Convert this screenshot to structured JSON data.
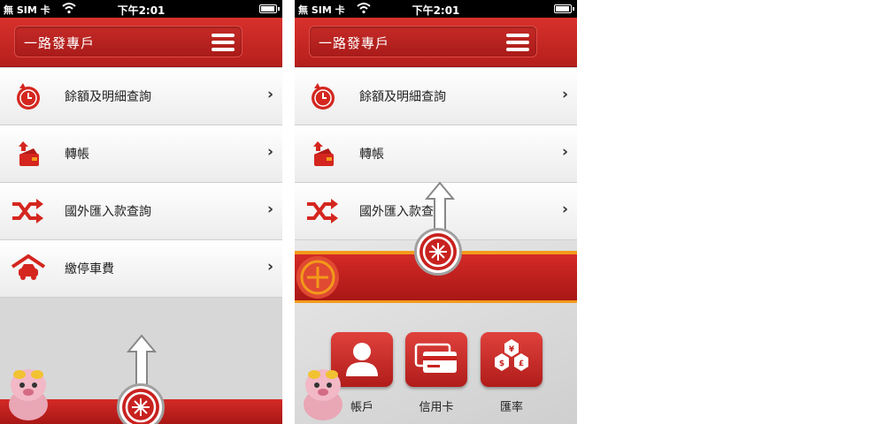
{
  "status": {
    "carrier": "無 SIM 卡",
    "time": "下午2:01",
    "battery": 0.9
  },
  "header": {
    "title": "一路發專戶"
  },
  "menu": [
    {
      "label": "餘額及明細查詢",
      "icon": "balance-clock-icon"
    },
    {
      "label": "轉帳",
      "icon": "transfer-wallet-icon"
    },
    {
      "label": "國外匯入款查詢",
      "icon": "shuffle-arrows-icon"
    },
    {
      "label": "繳停車費",
      "icon": "garage-car-icon"
    }
  ],
  "tiles": [
    {
      "label": "帳戶",
      "icon": "person-icon"
    },
    {
      "label": "信用卡",
      "icon": "credit-card-icon"
    },
    {
      "label": "匯率",
      "icon": "currency-icon"
    }
  ],
  "colors": {
    "brand_red": "#c8221f",
    "accent_orange": "#f39a1a"
  }
}
